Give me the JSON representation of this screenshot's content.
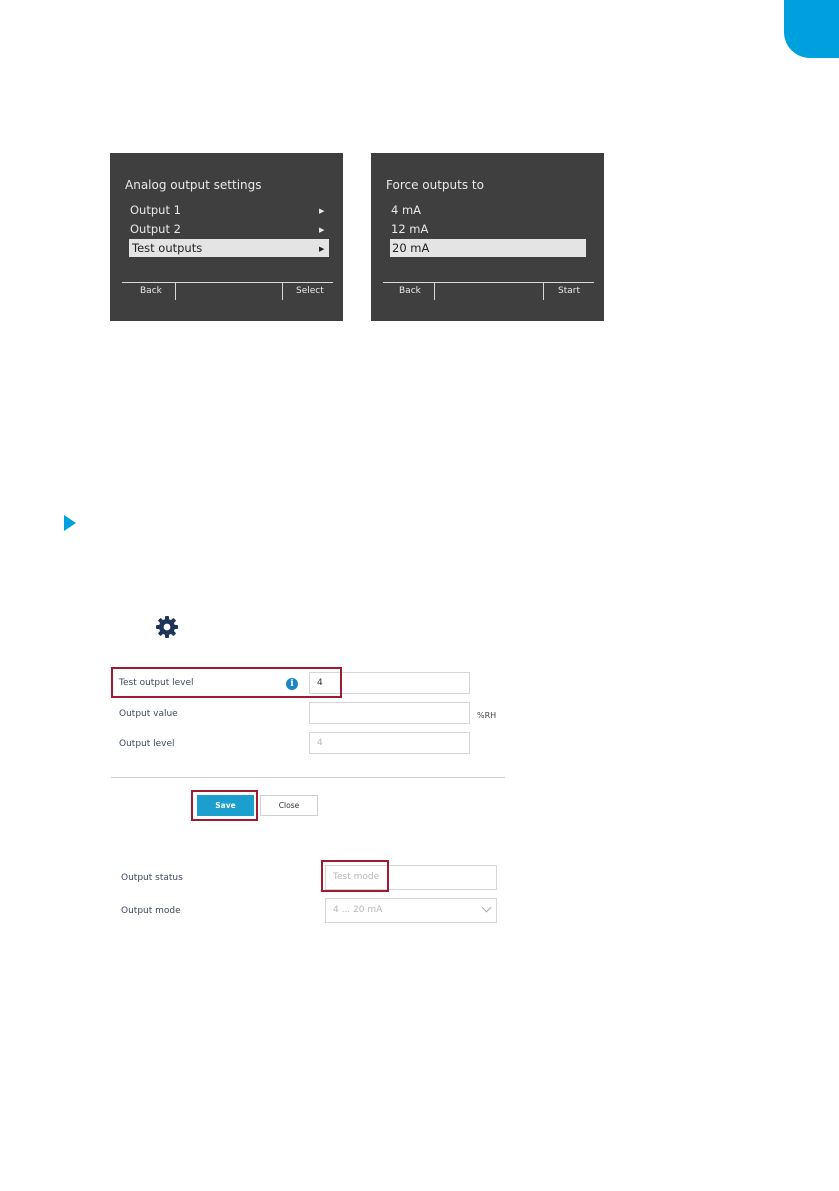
{
  "colors": {
    "accent": "#00a0df",
    "highlight": "#9e1b32",
    "button": "#1a9fce",
    "screen_bg": "#3f3f3f"
  },
  "device_screen_1": {
    "title": "Analog output settings",
    "items": [
      {
        "label": "Output 1",
        "arrow": "▶"
      },
      {
        "label": "Output 2",
        "arrow": "▶"
      },
      {
        "label": "Test outputs",
        "arrow": "▶",
        "selected": true
      }
    ],
    "softkey_left": "Back",
    "softkey_right": "Select"
  },
  "device_screen_2": {
    "title": "Force outputs to",
    "items": [
      {
        "label": "4 mA"
      },
      {
        "label": "12 mA"
      },
      {
        "label": "20 mA",
        "selected": true
      }
    ],
    "softkey_left": "Back",
    "softkey_right": "Start"
  },
  "icons": {
    "step": "play-triangle-icon",
    "settings": "gear-icon",
    "info": "info-icon"
  },
  "test_form": {
    "test_output_level": {
      "label": "Test output level",
      "value": "4"
    },
    "output_value": {
      "label": "Output value",
      "value": "",
      "unit": "%RH"
    },
    "output_level": {
      "label": "Output level",
      "value": "4"
    },
    "info_glyph": "i",
    "save_label": "Save",
    "close_label": "Close"
  },
  "status_form": {
    "output_status": {
      "label": "Output status",
      "value": "Test mode"
    },
    "output_mode": {
      "label": "Output mode",
      "value": "4 ... 20 mA"
    }
  }
}
